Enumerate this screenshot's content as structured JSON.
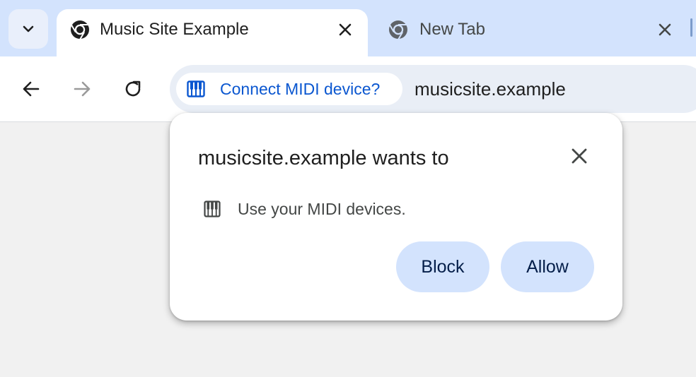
{
  "tabs": [
    {
      "title": "Music Site Example",
      "active": true,
      "icon": "chrome-icon"
    },
    {
      "title": "New Tab",
      "active": false,
      "icon": "chrome-icon"
    }
  ],
  "omnibox": {
    "chip_label": "Connect MIDI device?",
    "chip_icon": "piano-keys-icon",
    "url": "musicsite.example"
  },
  "dialog": {
    "heading": "musicsite.example wants to",
    "permission_text": "Use your MIDI devices.",
    "permission_icon": "piano-keys-icon",
    "block_label": "Block",
    "allow_label": "Allow"
  },
  "colors": {
    "tabstrip": "#d3e3fd",
    "accent": "#0b57d0",
    "button_bg": "#d3e3fd"
  }
}
